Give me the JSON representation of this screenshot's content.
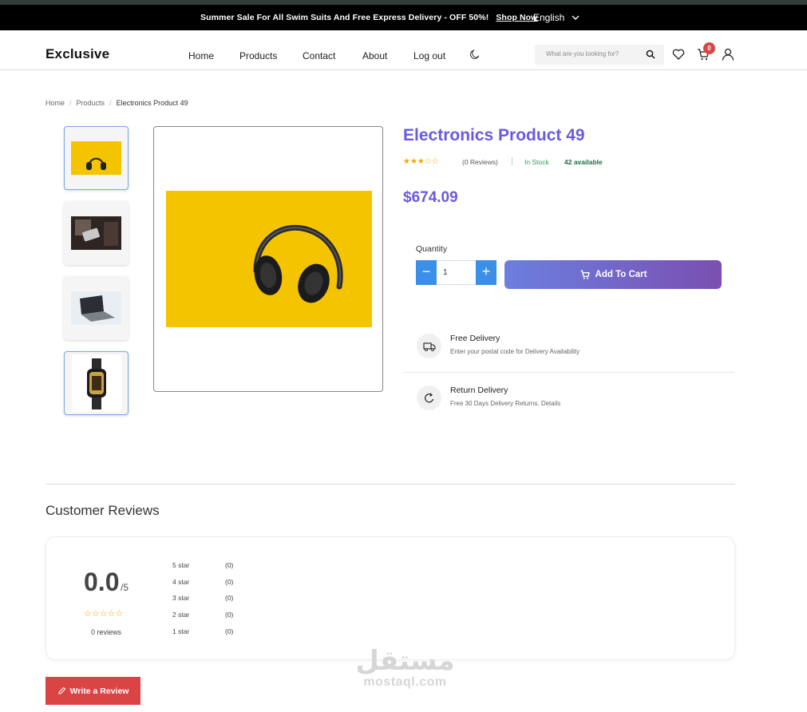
{
  "announcement": {
    "message": "Summer Sale For All Swim Suits And Free Express Delivery - OFF 50%!",
    "shop_now": "Shop Now",
    "language": "English"
  },
  "header": {
    "logo": "Exclusive",
    "nav": [
      "Home",
      "Products",
      "Contact",
      "About",
      "Log out"
    ],
    "search_placeholder": "What are you looking for?",
    "cart_count": "0"
  },
  "breadcrumb": [
    "Home",
    "Products",
    "Electronics Product 49"
  ],
  "product": {
    "title": "Electronics Product 49",
    "rating_stars": "★★★☆☆",
    "rating": 3,
    "reviews_label": "(0 Reviews)",
    "stock_status": "In Stock",
    "available": "42 available",
    "price": "$674.09",
    "quantity_label": "Quantity",
    "quantity_value": "1",
    "add_to_cart": "Add To Cart",
    "thumbnails": [
      "headphones-image",
      "phone-hand-image",
      "laptop-image",
      "smartwatch-image"
    ]
  },
  "features": [
    {
      "title": "Free Delivery",
      "subtitle": "Enter your postal code for Delivery Availability",
      "icon": "truck-icon"
    },
    {
      "title": "Return Delivery",
      "subtitle": "Free 30 Days Delivery Returns. Details",
      "icon": "return-icon"
    }
  ],
  "reviews": {
    "heading": "Customer Reviews",
    "score": "0.0",
    "score_of": "/5",
    "score_stars": "☆☆☆☆☆",
    "count_label": "0 reviews",
    "breakdown": [
      {
        "label": "5 star",
        "count": "(0)"
      },
      {
        "label": "4 star",
        "count": "(0)"
      },
      {
        "label": "3 star",
        "count": "(0)"
      },
      {
        "label": "2 star",
        "count": "(0)"
      },
      {
        "label": "1 star",
        "count": "(0)"
      }
    ],
    "write_button": "Write a Review"
  },
  "watermark": {
    "arabic": "مستقل",
    "latin": "mostaql.com"
  },
  "colors": {
    "accent": "#6a5ae0",
    "sale_red": "#db4444",
    "in_stock": "#27a05b",
    "qty_blue": "#3b8fe8",
    "star": "#f0a500"
  }
}
